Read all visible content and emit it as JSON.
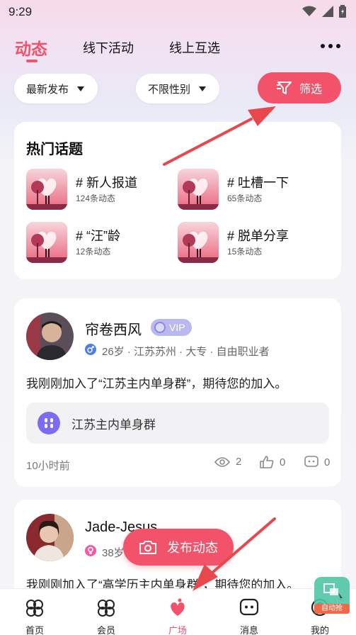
{
  "status_bar": {
    "time": "9:29"
  },
  "top_tabs": {
    "active": "动态",
    "items": [
      "线下活动",
      "线上互选"
    ]
  },
  "filters": {
    "sort": "最新发布",
    "gender": "不限性别",
    "screen_button": "筛选"
  },
  "hot_topics": {
    "title": "热门话题",
    "items": [
      {
        "name": "# 新人报道",
        "count": "124条动态"
      },
      {
        "name": "# 吐槽一下",
        "count": "65条动态"
      },
      {
        "name": "# “汪”龄",
        "count": "12条动态"
      },
      {
        "name": "# 脱单分享",
        "count": "15条动态"
      }
    ]
  },
  "posts": [
    {
      "name": "帘卷西风",
      "badge": "VIP",
      "meta": "26岁 · 江苏苏州 · 大专 · 自由职业者",
      "text": "我刚刚加入了“江苏主内单身群”，期待您的加入。",
      "group": "江苏主内单身群",
      "time": "10小时前",
      "views": "2",
      "likes": "0",
      "comments": "0",
      "gender_color": "#4a7df0"
    },
    {
      "name": "Jade-Jesus",
      "meta": "38岁",
      "text": "我刚刚加入了“高学历主内单身群”，期待您的加入。",
      "gender_color": "#f05aa6"
    }
  ],
  "publish_button": "发布动态",
  "bottom_nav": [
    {
      "label": "首页",
      "icon": "home-icon"
    },
    {
      "label": "会员",
      "icon": "member-icon"
    },
    {
      "label": "广场",
      "icon": "plaza-icon",
      "active": true
    },
    {
      "label": "消息",
      "icon": "message-icon"
    },
    {
      "label": "我的",
      "icon": "profile-icon"
    }
  ],
  "float_widget": {
    "label": "自动抢"
  },
  "colors": {
    "accent": "#f2536a",
    "vip": "#b9b8ef",
    "group_icon": "#7b6cf3"
  }
}
